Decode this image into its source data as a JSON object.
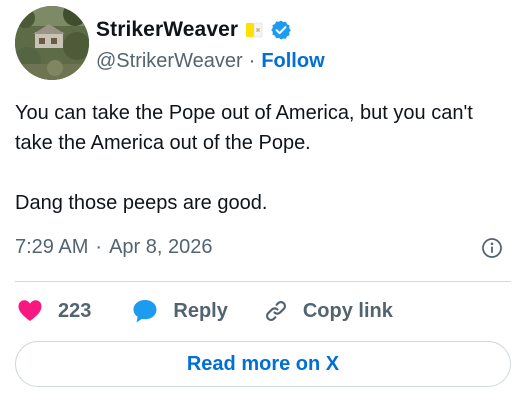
{
  "user": {
    "display_name": "StrikerWeaver",
    "handle": "@StrikerWeaver",
    "separator": "·",
    "follow_label": "Follow",
    "flag_icon": "vatican-flag-icon",
    "verified_icon": "verified-badge-icon"
  },
  "tweet": {
    "line1": "You can take the Pope out of America, but you can't take the America out of the Pope.",
    "line2": "Dang those peeps are good."
  },
  "meta": {
    "time": "7:29 AM",
    "separator": "·",
    "date": "Apr 8, 2026",
    "info_icon": "info-icon"
  },
  "actions": {
    "likes_count": "223",
    "reply_label": "Reply",
    "copy_link_label": "Copy link"
  },
  "footer": {
    "read_more_label": "Read more on X"
  },
  "colors": {
    "link_blue": "#006fd6",
    "heart_pink": "#f91880",
    "reply_blue": "#1d9bf0",
    "muted": "#536471",
    "text": "#0f1419",
    "border": "#cfd9de",
    "flag_yellow": "#ffe000"
  }
}
